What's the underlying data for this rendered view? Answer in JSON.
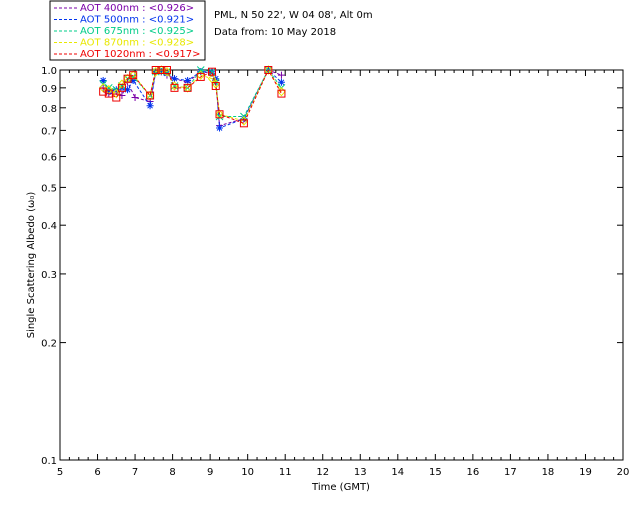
{
  "chart_data": {
    "type": "scatter",
    "xlabel": "Time (GMT)",
    "ylabel": "Single Scattering Albedo (ω₀)",
    "xlim": [
      5,
      20
    ],
    "ylim": [
      0.1,
      1.0
    ],
    "yscale": "log",
    "xticks": [
      "5",
      "6",
      "7",
      "8",
      "9",
      "10",
      "11",
      "12",
      "13",
      "14",
      "15",
      "16",
      "17",
      "18",
      "19",
      "20"
    ],
    "yticks": [
      "0.1",
      "0.2",
      "0.3",
      "0.4",
      "0.5",
      "0.6",
      "0.7",
      "0.8",
      "0.9",
      "1.0"
    ],
    "yticks_values": [
      0.1,
      0.2,
      0.3,
      0.4,
      0.5,
      0.6,
      0.7,
      0.8,
      0.9,
      1.0
    ],
    "legend_placement": "top-left outside",
    "info_lines": [
      "PML, N 50 22', W 04 08', Alt 0m",
      "Data from: 10 May 2018"
    ],
    "series": [
      {
        "name": "AOT  400nm : <0.926>",
        "color": "#7a00a8",
        "marker": "plus",
        "x": [
          6.15,
          6.3,
          6.5,
          6.65,
          6.8,
          7.0,
          7.4,
          7.55,
          7.7,
          7.85,
          8.05,
          8.4,
          8.75,
          9.05,
          9.15,
          9.25,
          9.9,
          10.55,
          10.9
        ],
        "y": [
          0.9,
          0.87,
          0.88,
          0.86,
          0.93,
          0.85,
          0.83,
          0.99,
          0.99,
          0.97,
          0.95,
          0.93,
          0.99,
          0.98,
          0.94,
          0.72,
          0.75,
          1.0,
          0.97
        ]
      },
      {
        "name": "AOT  500nm : <0.921>",
        "color": "#0033ee",
        "marker": "asterisk",
        "x": [
          6.15,
          6.3,
          6.5,
          6.65,
          6.8,
          6.95,
          7.4,
          7.55,
          7.7,
          7.85,
          8.05,
          8.4,
          8.75,
          9.05,
          9.15,
          9.25,
          9.9,
          10.55,
          10.9
        ],
        "y": [
          0.94,
          0.88,
          0.89,
          0.9,
          0.89,
          0.94,
          0.81,
          0.99,
          0.99,
          0.98,
          0.95,
          0.94,
          0.99,
          0.99,
          0.95,
          0.71,
          0.75,
          1.0,
          0.93
        ]
      },
      {
        "name": "AOT  675nm : <0.925>",
        "color": "#00cc88",
        "marker": "x",
        "x": [
          6.15,
          6.3,
          6.5,
          6.65,
          6.8,
          6.95,
          7.4,
          7.55,
          7.7,
          7.85,
          8.05,
          8.4,
          8.75,
          9.05,
          9.15,
          9.25,
          9.9,
          10.55,
          10.9
        ],
        "y": [
          0.92,
          0.9,
          0.89,
          0.91,
          0.95,
          0.96,
          0.86,
          0.99,
          1.0,
          0.99,
          0.91,
          0.9,
          1.0,
          0.99,
          0.93,
          0.76,
          0.76,
          1.0,
          0.9
        ]
      },
      {
        "name": "AOT  870nm : <0.928>",
        "color": "#e8e800",
        "marker": "diamond",
        "x": [
          6.15,
          6.3,
          6.5,
          6.65,
          6.8,
          6.95,
          7.4,
          7.55,
          7.7,
          7.85,
          8.05,
          8.4,
          8.75,
          9.05,
          9.15,
          9.25,
          9.9,
          10.55,
          10.9
        ],
        "y": [
          0.9,
          0.89,
          0.87,
          0.92,
          0.95,
          0.97,
          0.86,
          0.99,
          1.0,
          0.99,
          0.91,
          0.9,
          0.97,
          0.95,
          0.92,
          0.77,
          0.74,
          1.0,
          0.88
        ]
      },
      {
        "name": "AOT 1020nm : <0.917>",
        "color": "#ee0000",
        "marker": "square",
        "x": [
          6.15,
          6.3,
          6.5,
          6.65,
          6.8,
          6.95,
          7.4,
          7.55,
          7.7,
          7.85,
          8.05,
          8.4,
          8.75,
          9.05,
          9.15,
          9.25,
          9.9,
          10.55,
          10.9
        ],
        "y": [
          0.88,
          0.87,
          0.85,
          0.9,
          0.95,
          0.97,
          0.86,
          1.0,
          1.0,
          1.0,
          0.9,
          0.9,
          0.96,
          0.99,
          0.91,
          0.77,
          0.73,
          1.0,
          0.87
        ]
      }
    ]
  }
}
